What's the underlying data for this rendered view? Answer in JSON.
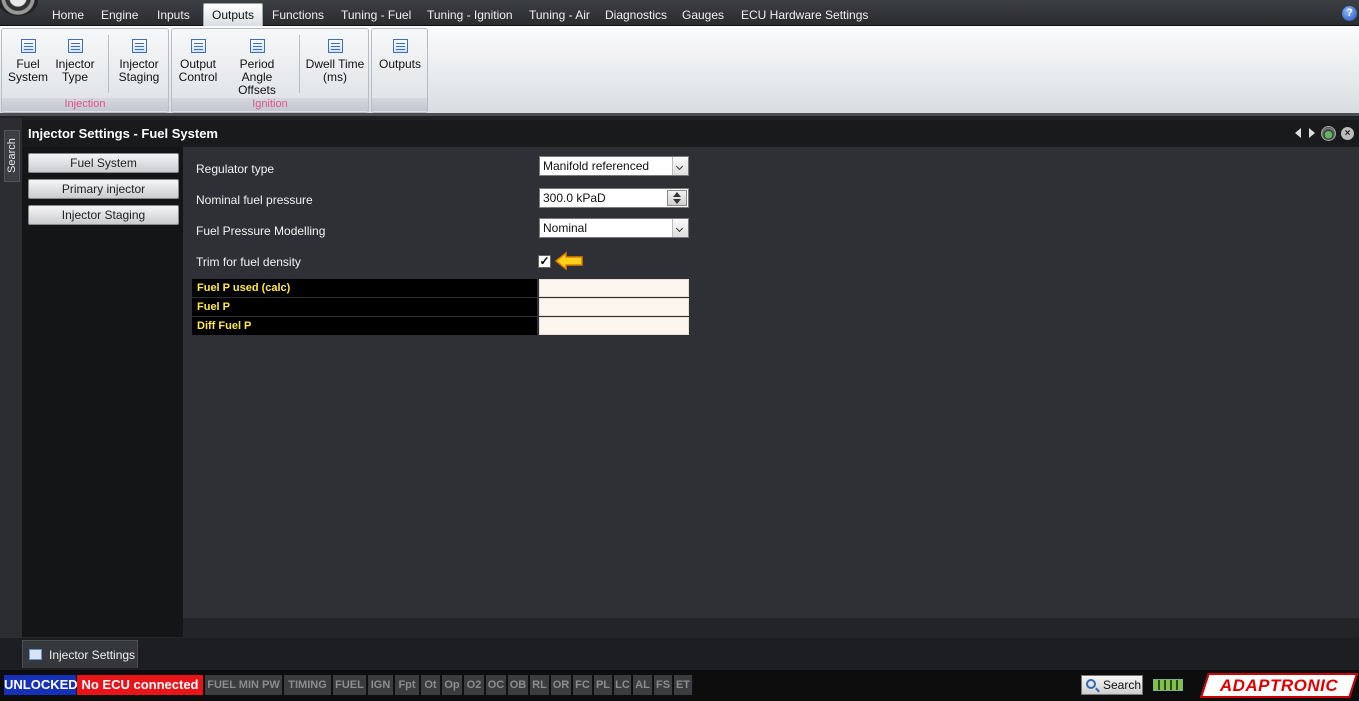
{
  "menu": {
    "tabs": [
      "Home",
      "Engine",
      "Inputs",
      "Outputs",
      "Functions",
      "Tuning - Fuel",
      "Tuning - Ignition",
      "Tuning - Air",
      "Diagnostics",
      "Gauges",
      "ECU Hardware Settings"
    ],
    "active_tab": "Outputs",
    "help_label": "?"
  },
  "ribbon": {
    "groups": [
      {
        "label": "Injection",
        "buttons": [
          {
            "label_line1": "Fuel",
            "label_line2": "System"
          },
          {
            "label_line1": "Injector",
            "label_line2": "Type"
          },
          {
            "label_line1": "Injector",
            "label_line2": "Staging"
          }
        ]
      },
      {
        "label": "Ignition",
        "buttons": [
          {
            "label_line1": "Output",
            "label_line2": "Control"
          },
          {
            "label_line1": "Period Angle",
            "label_line2": "Offsets"
          },
          {
            "label_line1": "Dwell Time",
            "label_line2": "(ms)"
          }
        ]
      },
      {
        "label": "",
        "buttons": [
          {
            "label_line1": "Outputs",
            "label_line2": ""
          }
        ]
      }
    ]
  },
  "search_side_label": "Search",
  "panel": {
    "title": "Injector Settings - Fuel System",
    "nav": [
      "Fuel System",
      "Primary injector",
      "Injector Staging"
    ]
  },
  "form": {
    "regulator_type": {
      "label": "Regulator type",
      "value": "Manifold referenced"
    },
    "nominal_fuel_pressure": {
      "label": "Nominal fuel pressure",
      "value": "300.0 kPaD"
    },
    "fuel_pressure_modelling": {
      "label": "Fuel Pressure Modelling",
      "value": "Nominal"
    },
    "trim_for_fuel_density": {
      "label": "Trim for fuel density",
      "checked": true,
      "check_glyph": "✓"
    }
  },
  "calc_rows": [
    {
      "label": "Fuel P used (calc)",
      "value": ""
    },
    {
      "label": "Fuel P",
      "value": ""
    },
    {
      "label": "Diff Fuel P",
      "value": ""
    }
  ],
  "doc_tab": "Injector Settings",
  "status": {
    "lock": "UNLOCKED",
    "connection": "No ECU connected",
    "indicators": [
      "FUEL MIN PW",
      "TIMING",
      "FUEL",
      "IGN",
      "Fpt",
      "Ot",
      "Op",
      "O2",
      "OC",
      "OB",
      "RL",
      "OR",
      "FC",
      "PL",
      "LC",
      "AL",
      "FS",
      "ET"
    ],
    "search_label": "Search",
    "brand": "ADAPTRONIC"
  },
  "colors": {
    "accent_yellow": "#ffe94a",
    "status_unlocked": "#1631b8",
    "status_error": "#e8141a",
    "ribbon_group_label": "#e0508a"
  }
}
